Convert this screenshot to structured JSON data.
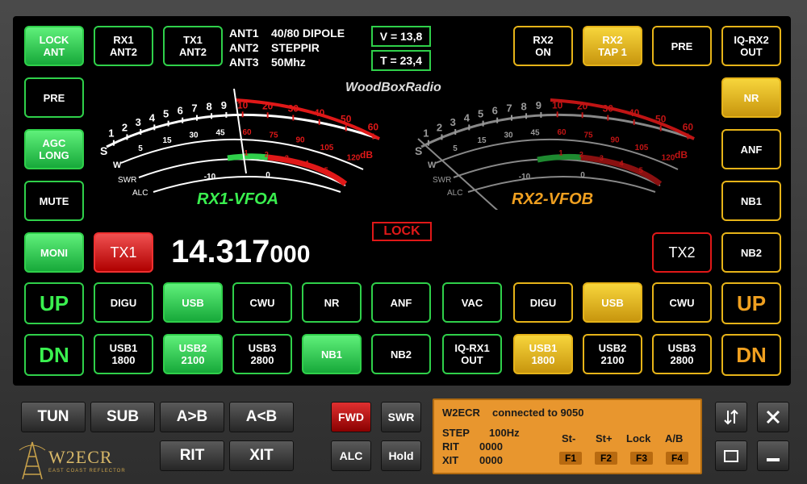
{
  "left_column": {
    "lock_ant": "LOCK\nANT",
    "pre": "PRE",
    "agc": "AGC\nLONG",
    "mute": "MUTE",
    "moni": "MONI",
    "up": "UP",
    "dn": "DN"
  },
  "top_buttons": {
    "rx1_ant": "RX1\nANT2",
    "tx1_ant": "TX1\nANT2",
    "rx2_on": "RX2\nON",
    "rx2_tap": "RX2\nTAP 1",
    "pre_right": "PRE",
    "iq_rx2": "IQ-RX2\nOUT"
  },
  "antennas": [
    {
      "label": "ANT1",
      "name": "40/80 DIPOLE"
    },
    {
      "label": "ANT2",
      "name": "STEPPIR"
    },
    {
      "label": "ANT3",
      "name": "50Mhz"
    }
  ],
  "telemetry": {
    "voltage": "V = 13,8",
    "temperature": "T = 23,4"
  },
  "brand": "WoodBoxRadio",
  "meters": {
    "rx1_label": "RX1-VFOA",
    "rx2_label": "RX2-VFOB",
    "s_scale": [
      "1",
      "2",
      "3",
      "4",
      "5",
      "6",
      "7",
      "8",
      "9"
    ],
    "s_scale_plus": [
      "10",
      "20",
      "30",
      "40",
      "50",
      "60"
    ],
    "w_scale": [
      "5",
      "15",
      "30",
      "45",
      "60",
      "75",
      "90",
      "105",
      "120"
    ],
    "swr_scale": [
      "1",
      "2",
      "3",
      "4",
      "5"
    ],
    "alc_scale": [
      "-10",
      "0"
    ],
    "labels": {
      "s": "S",
      "w": "W",
      "swr": "SWR",
      "alc": "ALC",
      "db": "dB"
    }
  },
  "lock_label": "LOCK",
  "tx1": "TX1",
  "tx2": "TX2",
  "frequency": {
    "main": "14.317",
    "sub": "000"
  },
  "right_column": {
    "nr": "NR",
    "anf": "ANF",
    "nb1": "NB1",
    "nb2": "NB2",
    "up": "UP",
    "dn": "DN"
  },
  "row_modes_1": [
    "DIGU",
    "USB",
    "CWU",
    "NR",
    "ANF",
    "VAC",
    "DIGU",
    "USB",
    "CWU"
  ],
  "row_modes_2": [
    "USB1\n1800",
    "USB2\n2100",
    "USB3\n2800",
    "NB1",
    "NB2",
    "IQ-RX1\nOUT",
    "USB1\n1800",
    "USB2\n2100",
    "USB3\n2800"
  ],
  "bottom": {
    "tun": "TUN",
    "sub": "SUB",
    "a_to_b": "A>B",
    "b_to_a": "A<B",
    "rit": "RIT",
    "xit": "XIT",
    "fwd": "FWD",
    "swr": "SWR",
    "alc": "ALC",
    "hold": "Hold"
  },
  "logo": {
    "name": "W2ECR",
    "tagline": "EAST COAST REFLECTOR"
  },
  "status_panel": {
    "callsign": "W2ECR",
    "connection": "connected to 9050",
    "step_label": "STEP",
    "step_value": "100Hz",
    "rit_label": "RIT",
    "rit_value": "0000",
    "xit_label": "XIT",
    "xit_value": "0000",
    "fn_labels": [
      "St-",
      "St+",
      "Lock",
      "A/B"
    ],
    "fn_keys": [
      "F1",
      "F2",
      "F3",
      "F4"
    ]
  },
  "window_icons": [
    "swap-icon",
    "close-icon",
    "maximize-icon",
    "minimize-icon"
  ],
  "colors": {
    "green": "#2fd04a",
    "yellow": "#e6b318",
    "red": "#e01818",
    "panel": "#e8962e"
  }
}
